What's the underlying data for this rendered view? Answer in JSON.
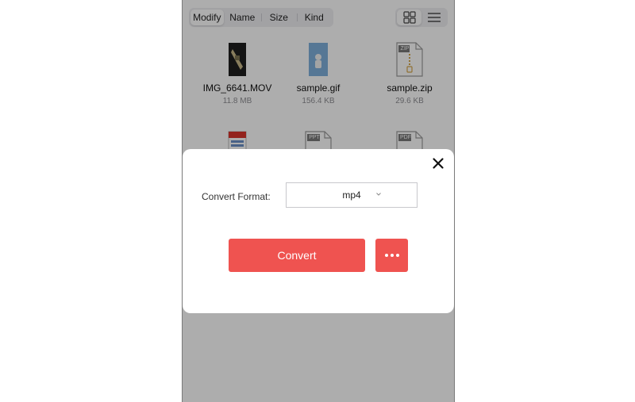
{
  "sort_bar": {
    "options": [
      "Modify",
      "Name",
      "Size",
      "Kind"
    ],
    "active": "Modify"
  },
  "view_toggle": {
    "active": "grid"
  },
  "files": [
    {
      "name": "IMG_6641.MOV",
      "size": "11.8 MB",
      "icon": "video-thumbnail-icon"
    },
    {
      "name": "sample.gif",
      "size": "156.4 KB",
      "icon": "gif-thumbnail-icon"
    },
    {
      "name": "sample.zip",
      "size": "29.6 KB",
      "icon": "zip-file-icon",
      "badge": "ZIP"
    },
    {
      "name": "",
      "size": "",
      "icon": "document-thumbnail-icon"
    },
    {
      "name": "",
      "size": "",
      "icon": "ppt-file-icon",
      "badge": "PPT"
    },
    {
      "name": "",
      "size": "",
      "icon": "pdf-file-icon",
      "badge": "PDF"
    }
  ],
  "dialog": {
    "label": "Convert Format:",
    "format_value": "mp4",
    "convert_label": "Convert",
    "more_icon": "more-dots-icon",
    "close_icon": "close-icon"
  },
  "colors": {
    "accent": "#ef5350",
    "overlay": "rgba(0,0,0,0.32)"
  }
}
